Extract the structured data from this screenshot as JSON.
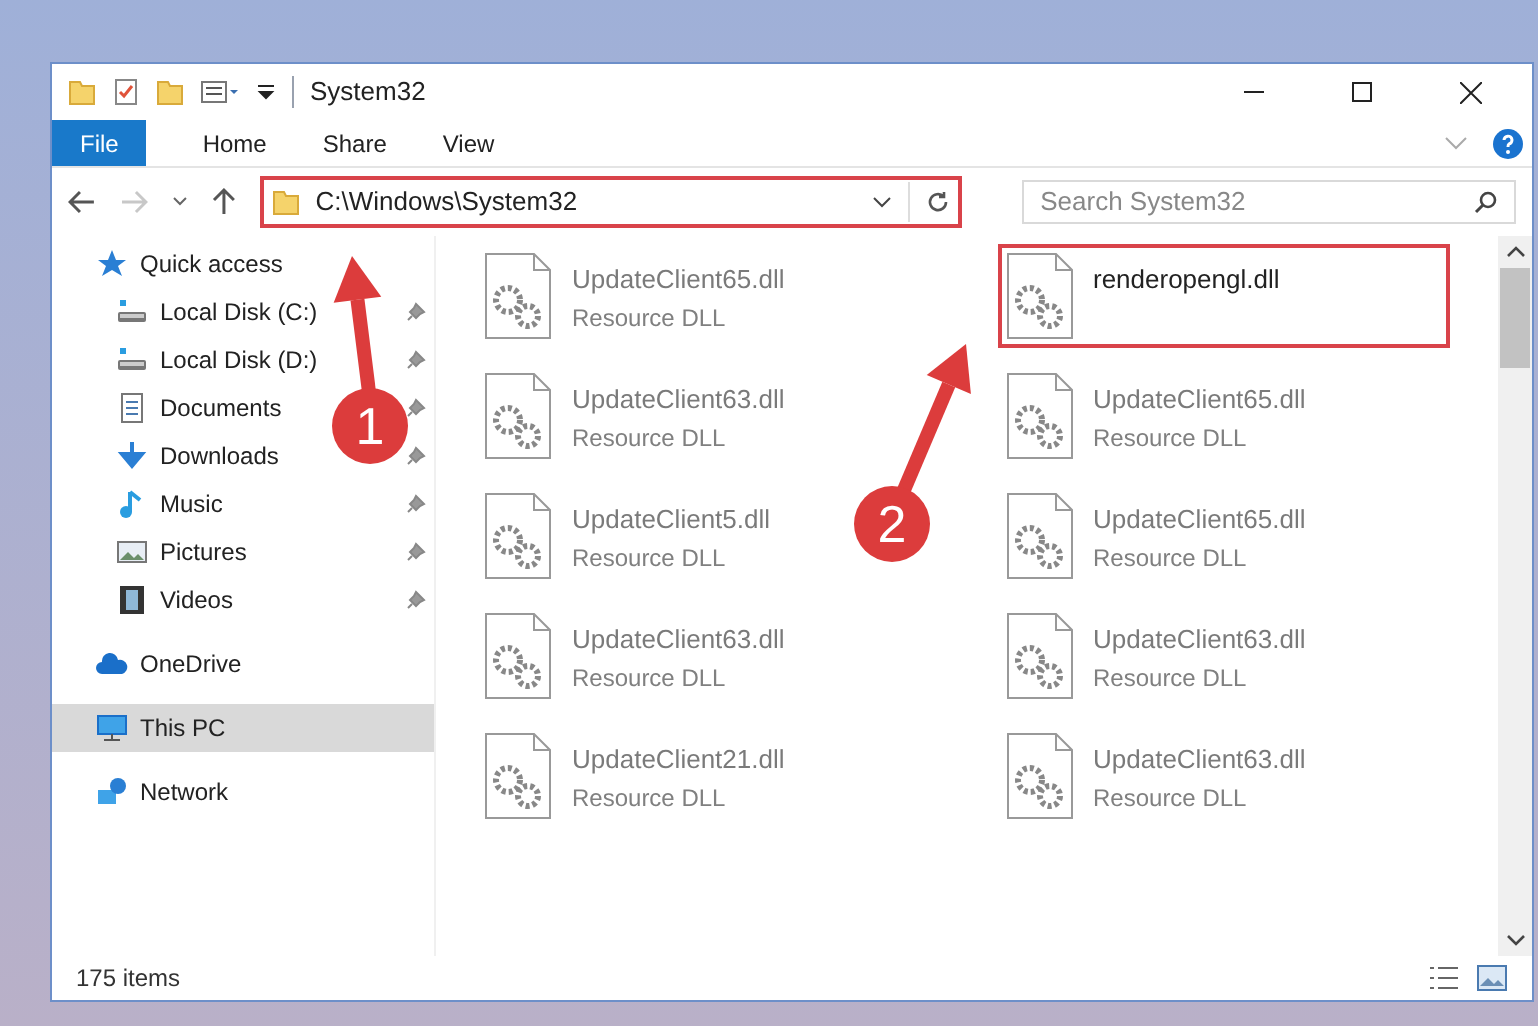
{
  "window": {
    "title": "System32"
  },
  "ribbon_tabs": [
    {
      "label": "File",
      "selected": true
    },
    {
      "label": "Home",
      "selected": false
    },
    {
      "label": "Share",
      "selected": false
    },
    {
      "label": "View",
      "selected": false
    }
  ],
  "address_bar": {
    "value": "C:\\Windows\\System32",
    "highlighted": true
  },
  "search": {
    "placeholder": "Search System32"
  },
  "sidebar": {
    "items": [
      {
        "label": "Quick access",
        "kind": "star",
        "pinned": false,
        "selected": false,
        "indent": false
      },
      {
        "label": "Local Disk (C:)",
        "kind": "drive",
        "pinned": true,
        "selected": false,
        "indent": true
      },
      {
        "label": "Local Disk (D:)",
        "kind": "drive",
        "pinned": true,
        "selected": false,
        "indent": true
      },
      {
        "label": "Documents",
        "kind": "document",
        "pinned": true,
        "selected": false,
        "indent": true
      },
      {
        "label": "Downloads",
        "kind": "download",
        "pinned": true,
        "selected": false,
        "indent": true
      },
      {
        "label": "Music",
        "kind": "music",
        "pinned": true,
        "selected": false,
        "indent": true
      },
      {
        "label": "Pictures",
        "kind": "picture",
        "pinned": true,
        "selected": false,
        "indent": true
      },
      {
        "label": "Videos",
        "kind": "video",
        "pinned": true,
        "selected": false,
        "indent": true
      },
      {
        "label": "OneDrive",
        "kind": "cloud",
        "pinned": false,
        "selected": false,
        "indent": false
      },
      {
        "label": "This PC",
        "kind": "computer",
        "pinned": false,
        "selected": true,
        "indent": false
      },
      {
        "label": "Network",
        "kind": "network",
        "pinned": false,
        "selected": false,
        "indent": false
      }
    ]
  },
  "files": [
    {
      "name": "UpdateClient65.dll",
      "type": "Resource DLL",
      "highlighted": false
    },
    {
      "name": "renderopengl.dll",
      "highlighted": true
    },
    {
      "name": "UpdateClient63.dll",
      "type": "Resource DLL",
      "highlighted": false
    },
    {
      "name": "UpdateClient65.dll",
      "type": "Resource DLL",
      "highlighted": false
    },
    {
      "name": "UpdateClient5.dll",
      "type": "Resource DLL",
      "highlighted": false
    },
    {
      "name": "UpdateClient65.dll",
      "type": "Resource DLL",
      "highlighted": false
    },
    {
      "name": "UpdateClient63.dll",
      "type": "Resource DLL",
      "highlighted": false
    },
    {
      "name": "UpdateClient63.dll",
      "type": "Resource DLL",
      "highlighted": false
    },
    {
      "name": "UpdateClient21.dll",
      "type": "Resource DLL",
      "highlighted": false
    },
    {
      "name": "UpdateClient63.dll",
      "type": "Resource DLL",
      "highlighted": false
    }
  ],
  "annotations": [
    {
      "number": "1"
    },
    {
      "number": "2"
    }
  ],
  "status_bar": {
    "count": "175 items"
  }
}
